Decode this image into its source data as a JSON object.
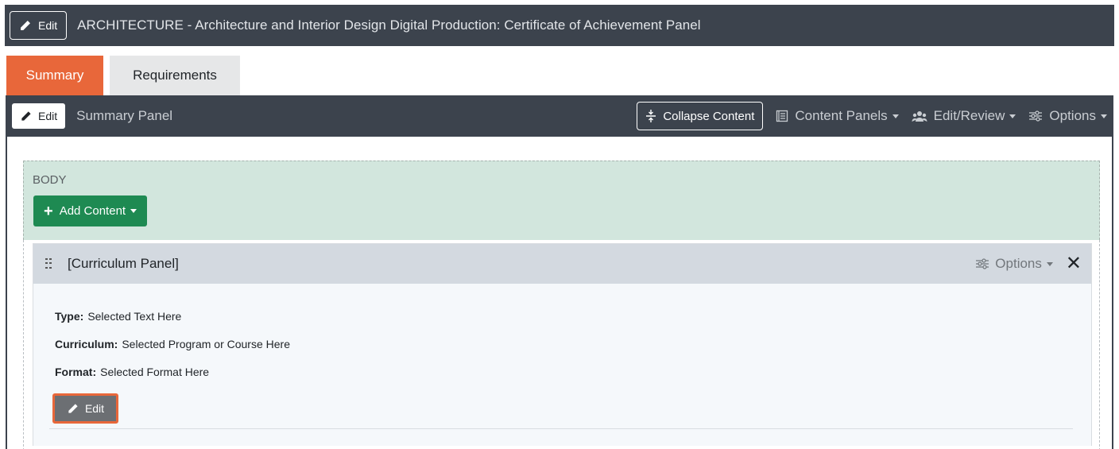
{
  "header": {
    "edit_label": "Edit",
    "title": "ARCHITECTURE - Architecture and Interior Design Digital Production: Certificate of Achievement Panel"
  },
  "tabs": [
    {
      "label": "Summary",
      "active": true
    },
    {
      "label": "Requirements",
      "active": false
    }
  ],
  "panel": {
    "edit_label": "Edit",
    "title": "Summary Panel",
    "collapse_label": "Collapse Content",
    "content_panels_label": "Content Panels",
    "edit_review_label": "Edit/Review",
    "options_label": "Options"
  },
  "body_zone": {
    "label": "BODY",
    "add_content_label": "Add Content"
  },
  "curriculum_panel": {
    "title": "[Curriculum Panel]",
    "options_label": "Options",
    "close_glyph": "✕",
    "fields": [
      {
        "label": "Type:",
        "value": "Selected Text Here"
      },
      {
        "label": "Curriculum:",
        "value": "Selected Program or Course Here"
      },
      {
        "label": "Format:",
        "value": "Selected Format Here"
      }
    ],
    "edit_label": "Edit"
  },
  "colors": {
    "bar_dark": "#3c434d",
    "tab_active": "#e8673a",
    "add_button": "#1e8a52",
    "body_zone": "#d2e6dd",
    "highlight": "#e8673a"
  }
}
